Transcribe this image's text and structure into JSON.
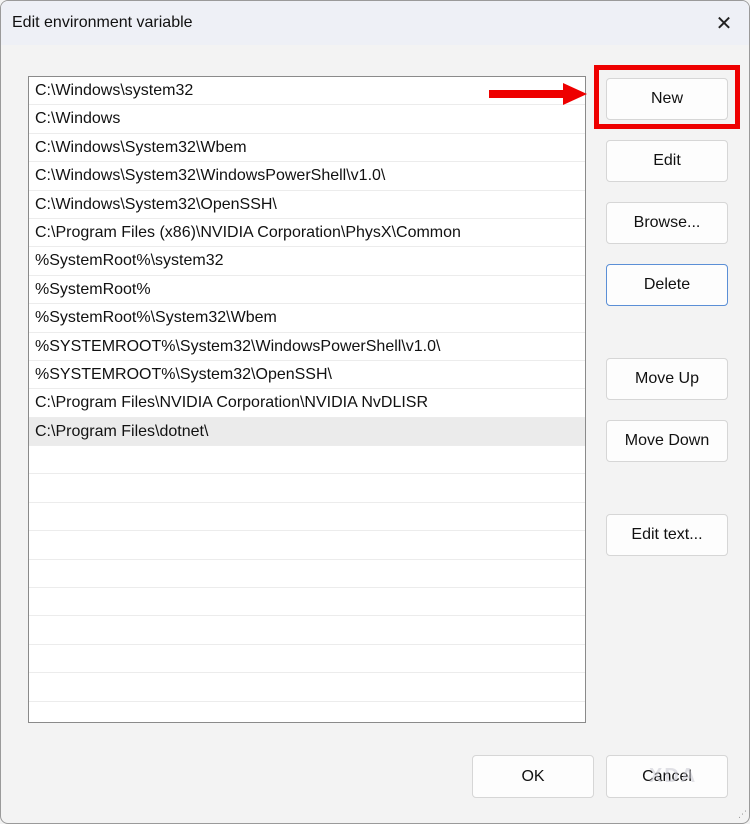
{
  "dialog": {
    "title": "Edit environment variable",
    "close_icon": "close-icon"
  },
  "list": {
    "items": [
      "C:\\Windows\\system32",
      "C:\\Windows",
      "C:\\Windows\\System32\\Wbem",
      "C:\\Windows\\System32\\WindowsPowerShell\\v1.0\\",
      "C:\\Windows\\System32\\OpenSSH\\",
      "C:\\Program Files (x86)\\NVIDIA Corporation\\PhysX\\Common",
      "%SystemRoot%\\system32",
      "%SystemRoot%",
      "%SystemRoot%\\System32\\Wbem",
      "%SYSTEMROOT%\\System32\\WindowsPowerShell\\v1.0\\",
      "%SYSTEMROOT%\\System32\\OpenSSH\\",
      "C:\\Program Files\\NVIDIA Corporation\\NVIDIA NvDLISR",
      "C:\\Program Files\\dotnet\\"
    ],
    "selected_index": 12
  },
  "buttons": {
    "new": "New",
    "edit": "Edit",
    "browse": "Browse...",
    "delete": "Delete",
    "move_up": "Move Up",
    "move_down": "Move Down",
    "edit_text": "Edit text...",
    "ok": "OK",
    "cancel": "Cancel"
  },
  "annotation_color": "#ee0000",
  "watermark": "XDA"
}
